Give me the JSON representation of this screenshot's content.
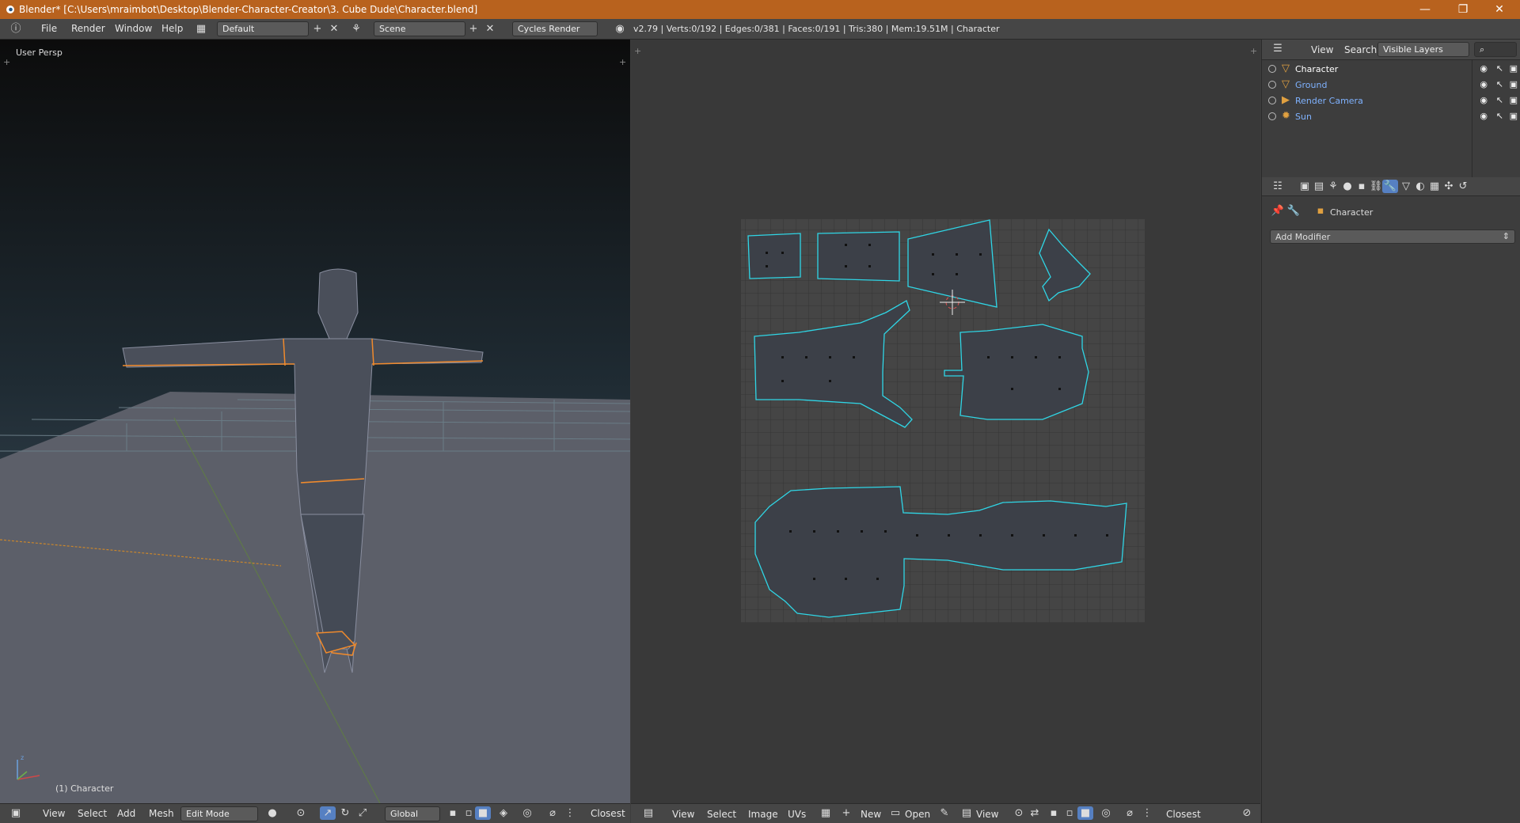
{
  "titlebar": {
    "title": "Blender* [C:\\Users\\mraimbot\\Desktop\\Blender-Character-Creator\\3. Cube Dude\\Character.blend]",
    "minimize": "—",
    "restore": "❐",
    "close": "✕"
  },
  "info_header": {
    "menu": [
      "File",
      "Render",
      "Window",
      "Help"
    ],
    "layout": "Default",
    "scene": "Scene",
    "engine": "Cycles Render",
    "stats": "v2.79 | Verts:0/192 | Edges:0/381 | Faces:0/191 | Tris:380 | Mem:19.51M | Character"
  },
  "viewport": {
    "view_name": "User Persp",
    "object_label": "(1) Character",
    "header": {
      "menu": [
        "View",
        "Select",
        "Add",
        "Mesh"
      ],
      "mode": "Edit Mode",
      "orientation": "Global",
      "snap": "Closest"
    }
  },
  "uv_editor": {
    "header": {
      "menu": [
        "View",
        "Select",
        "Image",
        "UVs"
      ],
      "new_label": "New",
      "open_label": "Open",
      "view_label": "View",
      "snap": "Closest"
    }
  },
  "outliner": {
    "menu": [
      "View",
      "Search"
    ],
    "display_mode": "Visible Layers",
    "items": [
      {
        "label": "Character",
        "color": "#ffffff",
        "icon": "mesh-icon"
      },
      {
        "label": "Ground",
        "color": "#7fb2ff",
        "icon": "mesh-icon"
      },
      {
        "label": "Render Camera",
        "color": "#7fb2ff",
        "icon": "camera-icon"
      },
      {
        "label": "Sun",
        "color": "#7fb2ff",
        "icon": "lamp-icon"
      }
    ]
  },
  "properties": {
    "object_name": "Character",
    "add_modifier": "Add Modifier"
  },
  "colors": {
    "uv_edge": "#2fd6e6",
    "selection_orange": "#f08a2c",
    "title_bar": "#b8621e"
  }
}
